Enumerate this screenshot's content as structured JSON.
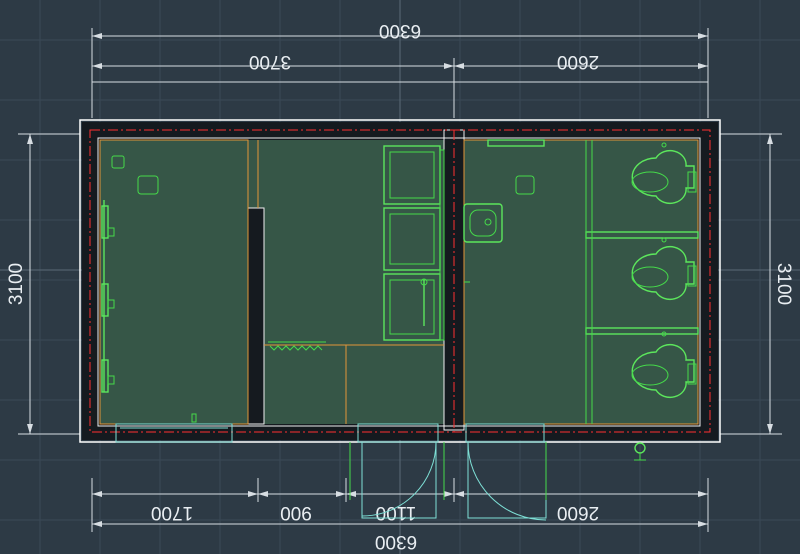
{
  "drawing": {
    "dimensions": {
      "top_overall": "6300",
      "top_left": "3700",
      "top_right": "2600",
      "left_height": "3100",
      "right_height": "3100",
      "bottom_seg_1": "1700",
      "bottom_seg_2": "900",
      "bottom_seg_3": "1100",
      "bottom_seg_4": "2600",
      "bottom_overall": "6300"
    },
    "colors": {
      "background": "#2d3a45",
      "wall": "#f0f0f0",
      "axis_line": "#ff3030",
      "room_fill": "#365647",
      "fixtures": "#45d94a",
      "partitions": "#e2953a",
      "openings": "#7ee0d6"
    }
  }
}
